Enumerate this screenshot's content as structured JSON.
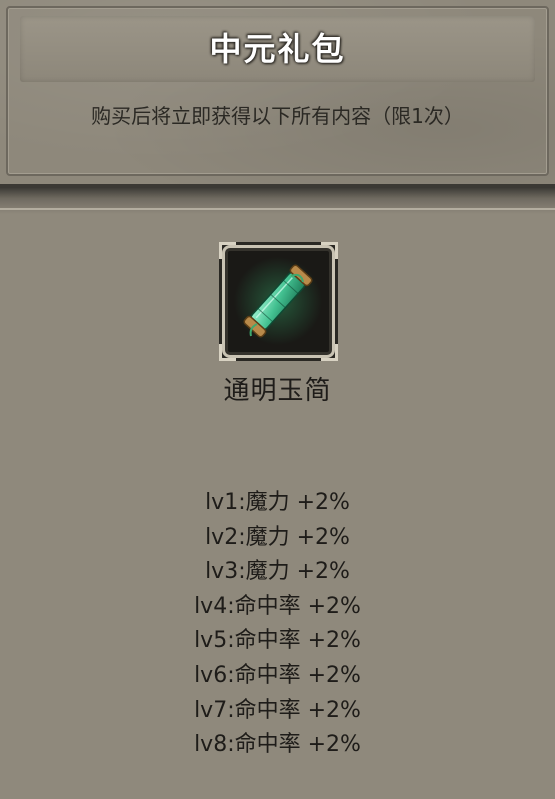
{
  "header": {
    "title": "中元礼包",
    "subtitle": "购买后将立即获得以下所有内容（限1次）"
  },
  "item": {
    "name": "通明玉简",
    "icon": "jade-scroll-icon"
  },
  "attributes": [
    "lv1:魔力 +2%",
    "lv2:魔力 +2%",
    "lv3:魔力 +2%",
    "lv4:命中率 +2%",
    "lv5:命中率 +2%",
    "lv6:命中率 +2%",
    "lv7:命中率 +2%",
    "lv8:命中率 +2%"
  ],
  "colors": {
    "panel": "#8f897c",
    "title_text": "#ffffff",
    "body_text": "#1e1c19",
    "jade": "#5fd6a8"
  }
}
